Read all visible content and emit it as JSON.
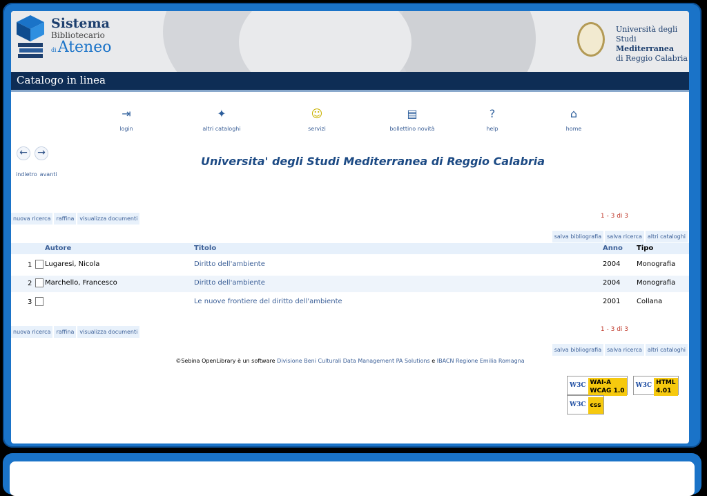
{
  "brand": {
    "line1": "Sistema",
    "line2": "Bibliotecario",
    "di": "di",
    "line3": "Ateneo"
  },
  "university": {
    "line1": "Università degli Studi",
    "line2": "Mediterranea",
    "line3": "di Reggio Calabria"
  },
  "titlebar": "Catalogo in linea",
  "nav": [
    {
      "label": "login"
    },
    {
      "label": "altri cataloghi"
    },
    {
      "label": "servizi"
    },
    {
      "label": "bollettino novità"
    },
    {
      "label": "help"
    },
    {
      "label": "home"
    }
  ],
  "history": {
    "back": "indietro",
    "forward": "avanti"
  },
  "main_title": "Universita' degli Studi Mediterranea di Reggio Calabria",
  "toolbar": {
    "new_search": "nuova ricerca",
    "refine": "raffina",
    "view_docs": "visualizza documenti",
    "pager": "1 - 3  di 3",
    "save_bib": "salva bibliografia",
    "save_search": "salva ricerca",
    "other_catalogs": "altri cataloghi"
  },
  "table": {
    "headers": {
      "autore": "Autore",
      "titolo": "Titolo",
      "anno": "Anno",
      "tipo": "Tipo"
    },
    "rows": [
      {
        "num": "1",
        "autore": "Lugaresi, Nicola",
        "titolo": "Diritto dell'ambiente",
        "anno": "2004",
        "tipo": "Monografia"
      },
      {
        "num": "2",
        "autore": "Marchello, Francesco",
        "titolo": "Diritto dell'ambiente",
        "anno": "2004",
        "tipo": "Monografia"
      },
      {
        "num": "3",
        "autore": "",
        "titolo": "Le nuove frontiere del diritto dell'ambiente",
        "anno": "2001",
        "tipo": "Collana"
      }
    ]
  },
  "footer": {
    "prefix": "©Sebina OpenLibrary è un software ",
    "link1": "Divisione Beni Culturali Data Management PA Solutions",
    "and": " e ",
    "link2": "IBACN Regione Emilia Romagna"
  },
  "badges": {
    "w3c": "W3C",
    "wai": "WAI-A",
    "wai_sub": "WCAG 1.0",
    "html": "HTML",
    "html_sub": "4.01",
    "css": "css"
  }
}
